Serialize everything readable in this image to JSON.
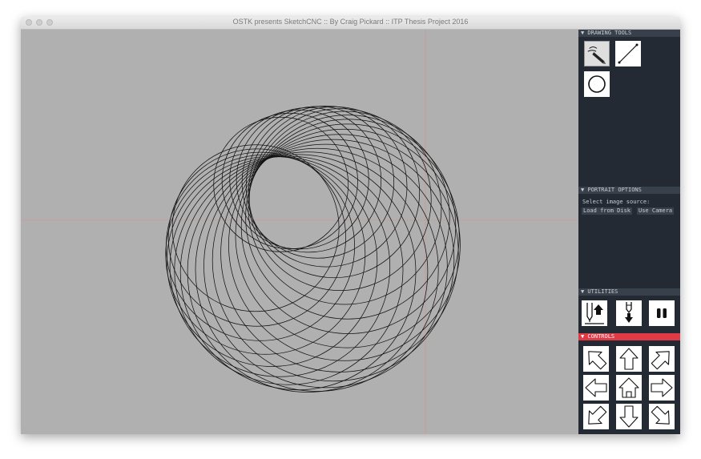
{
  "window": {
    "title": "OSTK presents SketchCNC :: By Craig Pickard :: ITP Thesis Project 2016"
  },
  "colors": {
    "canvas": "#b0b0b0",
    "panel": "#242a33",
    "section_header": "#38404b",
    "controls_header": "#e03a46",
    "guide": "#d09090"
  },
  "panel": {
    "drawing_tools": {
      "header": "▼ DRAWING TOOLS",
      "tools": [
        {
          "icon": "pencil-icon",
          "selected": true
        },
        {
          "icon": "line-icon",
          "selected": false
        },
        {
          "icon": "circle-icon",
          "selected": false
        }
      ]
    },
    "portrait_options": {
      "header": "▼ PORTRAIT OPTIONS",
      "label": "Select image source:",
      "buttons": [
        "Load from Disk",
        "Use Camera"
      ]
    },
    "utilities": {
      "header": "▼ UTILITIES",
      "buttons": [
        {
          "icon": "pen-up-icon"
        },
        {
          "icon": "pen-down-icon"
        },
        {
          "icon": "pause-icon"
        }
      ]
    },
    "controls": {
      "header": "▼ CONTROLS",
      "buttons": [
        {
          "icon": "arrow-up-left-icon"
        },
        {
          "icon": "arrow-up-icon"
        },
        {
          "icon": "arrow-up-right-icon"
        },
        {
          "icon": "arrow-left-icon"
        },
        {
          "icon": "home-icon"
        },
        {
          "icon": "arrow-right-icon"
        },
        {
          "icon": "arrow-down-left-icon"
        },
        {
          "icon": "arrow-down-icon"
        },
        {
          "icon": "arrow-down-right-icon"
        }
      ]
    }
  }
}
